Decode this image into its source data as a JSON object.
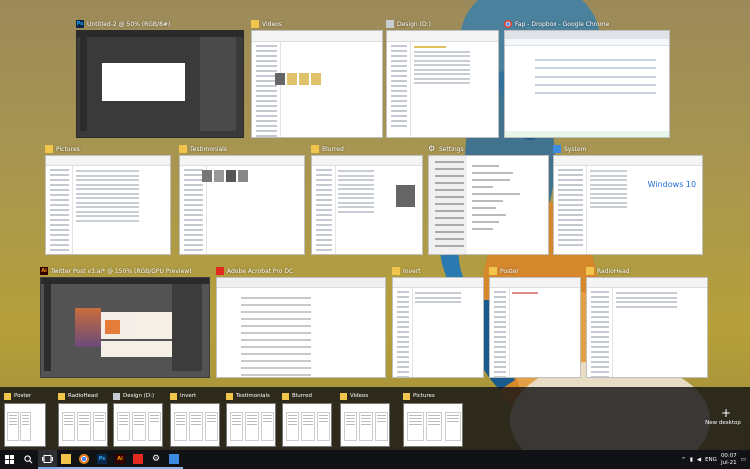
{
  "windows_row1": [
    {
      "title": "Untitled-2 @ 50% (RGB/8#)",
      "icon": "photoshop-icon",
      "icon_color": "#0b2a4a",
      "icon_letter": "Ps",
      "kind": "photoshop"
    },
    {
      "title": "Videos",
      "icon": "folder-icon",
      "icon_color": "#f1c44b",
      "kind": "explorer"
    },
    {
      "title": "Design (D:)",
      "icon": "drive-icon",
      "icon_color": "#c7ccd3",
      "kind": "explorer"
    },
    {
      "title": "Fap - Dropbox - Google Chrome",
      "icon": "chrome-icon",
      "icon_color": "#4285f4",
      "kind": "chrome"
    }
  ],
  "windows_row2": [
    {
      "title": "Pictures",
      "icon": "folder-icon",
      "icon_color": "#f1c44b",
      "kind": "explorer"
    },
    {
      "title": "Testimonials",
      "icon": "folder-icon",
      "icon_color": "#f1c44b",
      "kind": "explorer"
    },
    {
      "title": "Blurred",
      "icon": "folder-icon",
      "icon_color": "#f1c44b",
      "kind": "explorer"
    },
    {
      "title": "Settings",
      "icon": "gear-icon",
      "icon_color": "#ffffff",
      "kind": "settings"
    },
    {
      "title": "System",
      "icon": "computer-icon",
      "icon_color": "#3c8be0",
      "kind": "system",
      "logo_text": "Windows 10"
    }
  ],
  "windows_row3": [
    {
      "title": "Twitter Post v3.ai* @ 150% (RGB/GPU Preview)",
      "icon": "illustrator-icon",
      "icon_color": "#ff7c00",
      "icon_letter": "Ai",
      "kind": "illustrator"
    },
    {
      "title": "Adobe Acrobat Pro DC",
      "icon": "acrobat-icon",
      "icon_color": "#e32a1e",
      "kind": "acrobat"
    },
    {
      "title": "Invert",
      "icon": "folder-icon",
      "icon_color": "#f1c44b",
      "kind": "explorer"
    },
    {
      "title": "Poster",
      "icon": "folder-icon",
      "icon_color": "#f1c44b",
      "kind": "explorer"
    },
    {
      "title": "RadioHead",
      "icon": "folder-icon",
      "icon_color": "#f1c44b",
      "kind": "explorer"
    }
  ],
  "desktops": [
    {
      "label": "Poster"
    },
    {
      "label": "RadioHead"
    },
    {
      "label": "Design (D:)"
    },
    {
      "label": "Invert"
    },
    {
      "label": "Testimonials"
    },
    {
      "label": "Blurred"
    },
    {
      "label": "Videos"
    },
    {
      "label": "Pictures"
    }
  ],
  "new_desktop": {
    "plus": "+",
    "label": "New desktop"
  },
  "taskbar": {
    "apps": [
      {
        "name": "file-explorer-icon",
        "color": "#f1c44b",
        "letter": "",
        "running": true
      },
      {
        "name": "chrome-icon",
        "color": "#4285f4",
        "letter": "",
        "running": true
      },
      {
        "name": "photoshop-icon",
        "color": "#0b2a4a",
        "letter": "Ps",
        "running": true
      },
      {
        "name": "illustrator-icon",
        "color": "#ff7c00",
        "letter": "Ai",
        "running": true
      },
      {
        "name": "acrobat-icon",
        "color": "#e32a1e",
        "letter": "",
        "running": true
      },
      {
        "name": "settings-icon",
        "color": "#101215",
        "letter": "",
        "running": true
      },
      {
        "name": "system-icon",
        "color": "#3c8be0",
        "letter": "",
        "running": true
      }
    ],
    "tray": {
      "language": "ENG",
      "time": "00:07",
      "date": "Jul-21"
    }
  },
  "colors": {
    "accent": "#7aa7e6",
    "taskbar": "#101215",
    "folder": "#f1c44b"
  }
}
